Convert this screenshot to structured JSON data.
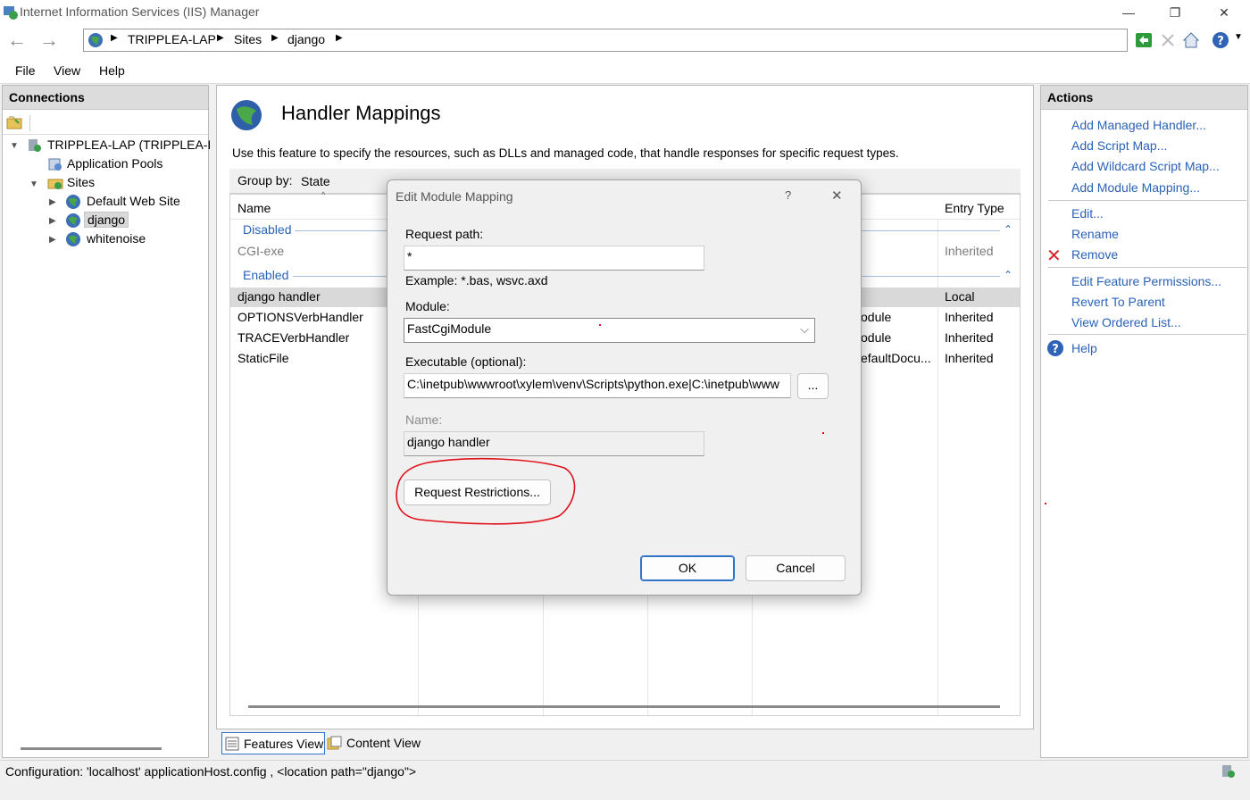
{
  "window": {
    "title": "Internet Information Services (IIS) Manager",
    "minimize": "—",
    "maximize": "❐",
    "close": "✕"
  },
  "nav": {
    "back": "←",
    "forward": "→",
    "breadcrumbs": [
      "TRIPPLEA-LAP",
      "Sites",
      "django"
    ],
    "help_glyph": "?"
  },
  "menu": [
    "File",
    "View",
    "Help"
  ],
  "connections": {
    "title": "Connections",
    "tree": {
      "server": "TRIPPLEA-LAP (TRIPPLEA-LAP",
      "app_pools": "Application Pools",
      "sites": "Sites",
      "site_items": [
        "Default Web Site",
        "django",
        "whitenoise"
      ]
    }
  },
  "center": {
    "title": "Handler Mappings",
    "description": "Use this feature to specify the resources, such as DLLs and managed code, that handle responses for specific request types.",
    "group_by_label": "Group by:",
    "group_by_value": "State",
    "columns": {
      "name": "Name",
      "entry_type": "Entry Type"
    },
    "groups": {
      "disabled": "Disabled",
      "enabled": "Enabled"
    },
    "disabled_rows": [
      {
        "name": "CGI-exe",
        "entry_type": "Inherited"
      }
    ],
    "enabled_rows": [
      {
        "name": "django handler",
        "partial": "",
        "entry_type": "Local"
      },
      {
        "name": "OPTIONSVerbHandler",
        "partial": "odule",
        "entry_type": "Inherited"
      },
      {
        "name": "TRACEVerbHandler",
        "partial": "odule",
        "entry_type": "Inherited"
      },
      {
        "name": "StaticFile",
        "partial": "efaultDocu...",
        "entry_type": "Inherited"
      }
    ]
  },
  "tabs": {
    "features": "Features View",
    "content": "Content View"
  },
  "actions": {
    "title": "Actions",
    "group1": [
      "Add Managed Handler...",
      "Add Script Map...",
      "Add Wildcard Script Map...",
      "Add Module Mapping..."
    ],
    "group2": [
      "Edit...",
      "Rename",
      "Remove"
    ],
    "group3": [
      "Edit Feature Permissions...",
      "Revert To Parent",
      "View Ordered List..."
    ],
    "help": "Help"
  },
  "status": "Configuration: 'localhost' applicationHost.config , <location path=\"django\">",
  "dialog": {
    "title": "Edit Module Mapping",
    "help": "?",
    "close": "✕",
    "request_path_label": "Request path:",
    "request_path_value": "*",
    "example": "Example: *.bas, wsvc.axd",
    "module_label": "Module:",
    "module_value": "FastCgiModule",
    "executable_label": "Executable (optional):",
    "executable_value": "C:\\inetpub\\wwwroot\\xylem\\venv\\Scripts\\python.exe|C:\\inetpub\\www",
    "browse": "...",
    "name_label": "Name:",
    "name_value": "django handler",
    "restrictions": "Request Restrictions...",
    "ok": "OK",
    "cancel": "Cancel"
  },
  "colors": {
    "link": "#2a62b8",
    "annotation": "#e0101a",
    "selection": "#d9d9d9"
  }
}
